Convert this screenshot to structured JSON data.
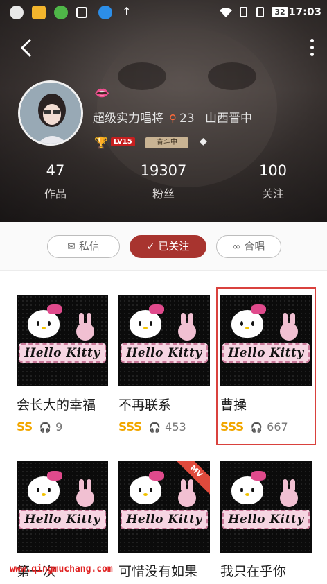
{
  "status_bar": {
    "battery": "32",
    "time": "17:03"
  },
  "profile": {
    "nickname": "超级实力唱将",
    "ring_count": "23",
    "location": "山西晋中",
    "level_badge": "LV15",
    "rank_badge": "奋斗中",
    "stats": [
      {
        "value": "47",
        "label": "作品"
      },
      {
        "value": "19307",
        "label": "粉丝"
      },
      {
        "value": "100",
        "label": "关注"
      }
    ]
  },
  "actions": {
    "message": "私信",
    "follow": "已关注",
    "duet": "合唱"
  },
  "thumbnail_text": "Hello Kitty",
  "songs": [
    {
      "title": "会长大的幸福",
      "grade": "SS",
      "plays": "9",
      "mv": false
    },
    {
      "title": "不再联系",
      "grade": "SSS",
      "plays": "453",
      "mv": false
    },
    {
      "title": "曹操",
      "grade": "SSS",
      "plays": "667",
      "mv": false
    },
    {
      "title": "第一次",
      "grade": "",
      "plays": "",
      "mv": false
    },
    {
      "title": "可惜没有如果",
      "grade": "",
      "plays": "",
      "mv": true
    },
    {
      "title": "我只在乎你",
      "grade": "",
      "plays": "",
      "mv": false
    }
  ],
  "mv_label": "MV",
  "watermark": "www.qingmuchang.com",
  "colors": {
    "accent": "#a8342f",
    "grade": "#f2a700",
    "highlight": "#d9413d"
  }
}
